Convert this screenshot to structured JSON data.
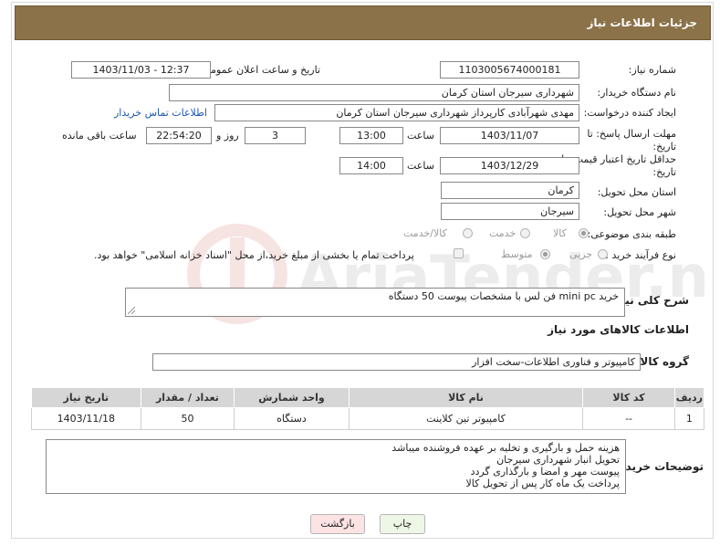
{
  "header": {
    "title": "جزئیات اطلاعات نیاز"
  },
  "fields": {
    "need_number_label": "شماره نیاز:",
    "need_number": "1103005674000181",
    "announce_label": "تاریخ و ساعت اعلان عمومی:",
    "announce_value": "1403/11/03 - 12:37",
    "buyer_org_label": "نام دستگاه خریدار:",
    "buyer_org": "شهرداری سیرجان استان کرمان",
    "creator_label": "ایجاد کننده درخواست:",
    "creator": "مهدی شهرآبادی کارپرداز شهرداری سیرجان استان کرمان",
    "contact_link": "اطلاعات تماس خریدار",
    "deadline_label": "مهلت ارسال پاسخ: تا تاریخ:",
    "deadline_date": "1403/11/07",
    "hour_label": "ساعت",
    "deadline_time": "13:00",
    "days_value": "3",
    "days_label": "روز و",
    "remaining_time": "22:54:20",
    "remaining_label": "ساعت باقی مانده",
    "price_valid_label": "حداقل تاریخ اعتبار قیمت: تا تاریخ:",
    "price_valid_date": "1403/12/29",
    "price_valid_time": "14:00",
    "province_label": "استان محل تحویل:",
    "province": "کرمان",
    "city_label": "شهر محل تحویل:",
    "city": "سیرجان",
    "category_label": "طبقه بندی موضوعی:",
    "category_options": [
      "کالا",
      "خدمت",
      "کالا/خدمت"
    ],
    "process_label": "نوع فرآیند خرید :",
    "process_options": [
      "جزیی",
      "متوسط"
    ],
    "process_note": "پرداخت تمام یا بخشی از مبلغ خرید،از محل \"اسناد خزانه اسلامی\" خواهد بود.",
    "description_label": "شرح کلی نیاز:",
    "description": "خرید mini pc  فن لس با مشخصات پیوست 50 دستگاه",
    "goods_info_title": "اطلاعات کالاهای مورد نیاز",
    "goods_group_label": "گروه کالا:",
    "goods_group": "کامپیوتر و فناوری اطلاعات-سخت افزار",
    "buyer_notes_label": "توضیحات خریدار:",
    "buyer_notes": [
      "هزینه حمل و بارگیری و تخلیه بر عهده فروشنده میباشد",
      "تحویل انبار شهرداری سیرجان",
      "پیوست مهر و امضا و بارگذاری گردد",
      "پرداخت یک ماه کار پس از تحویل کالا"
    ]
  },
  "table": {
    "headers": [
      "ردیف",
      "کد کالا",
      "نام کالا",
      "واحد شمارش",
      "تعداد / مقدار",
      "تاریخ نیاز"
    ],
    "rows": [
      [
        "1",
        "--",
        "کامپیوتر تین کلاینت",
        "دستگاه",
        "50",
        "1403/11/18"
      ]
    ]
  },
  "buttons": {
    "print": "چاپ",
    "back": "بازگشت"
  },
  "watermark": "AriaTender.net",
  "colors": {
    "header_bg": "#8b7248",
    "link": "#1a57b5",
    "back_button_bg": "#fde3e3",
    "print_button_bg": "#eef7e6"
  }
}
